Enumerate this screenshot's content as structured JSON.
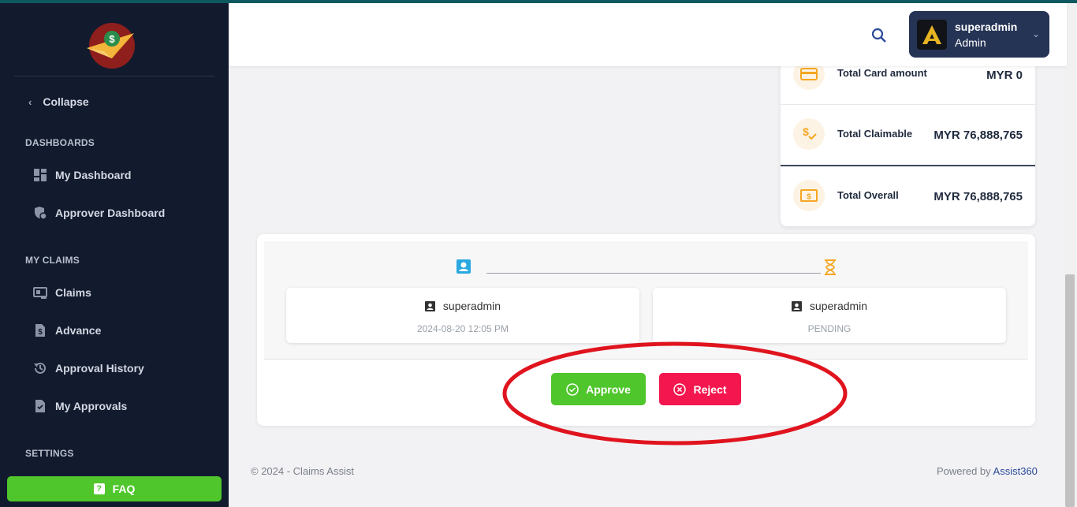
{
  "sidebar": {
    "collapse_label": "Collapse",
    "sections": {
      "dashboards": "DASHBOARDS",
      "my_claims": "MY CLAIMS",
      "settings": "SETTINGS"
    },
    "items": {
      "my_dashboard": "My Dashboard",
      "approver_dashboard": "Approver Dashboard",
      "claims": "Claims",
      "advance": "Advance",
      "approval_history": "Approval History",
      "my_approvals": "My Approvals"
    },
    "faq_label": "FAQ"
  },
  "header": {
    "user_name": "superadmin",
    "user_role": "Admin"
  },
  "summary": {
    "rows": [
      {
        "label": "Total Card amount",
        "value": "MYR 0"
      },
      {
        "label": "Total Claimable",
        "value": "MYR 76,888,765"
      },
      {
        "label": "Total Overall",
        "value": "MYR 76,888,765"
      }
    ]
  },
  "approval": {
    "steps": [
      {
        "name": "superadmin",
        "detail": "2024-08-20 12:05 PM"
      },
      {
        "name": "superadmin",
        "detail": "PENDING"
      }
    ],
    "approve_label": "Approve",
    "reject_label": "Reject"
  },
  "footer": {
    "copyright": "© 2024 - Claims Assist",
    "powered_prefix": "Powered by ",
    "powered_brand": "Assist360"
  },
  "colors": {
    "sidebar_bg": "#121a2e",
    "approve": "#4fc62b",
    "reject": "#f4164e",
    "accent_orange": "#f5a623",
    "annotation_red": "#e0141e"
  }
}
